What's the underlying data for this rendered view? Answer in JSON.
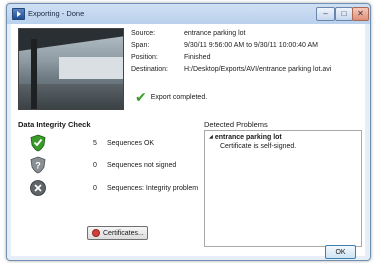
{
  "window": {
    "title": "Exporting - Done",
    "min": "–",
    "max": "□",
    "close": "✕"
  },
  "export_info": {
    "source_label": "Source:",
    "source_value": "entrance parking lot",
    "span_label": "Span:",
    "span_value": "9/30/11 9:56:00 AM to 9/30/11 10:00:40 AM",
    "position_label": "Position:",
    "position_value": "Finished",
    "destination_label": "Destination:",
    "destination_value": "H:/Desktop/Exports/AVI/entrance parking lot.avi"
  },
  "status": {
    "icon": "checkmark-icon",
    "text": "Export completed."
  },
  "integrity": {
    "title": "Data Integrity Check",
    "rows": [
      {
        "icon": "shield-ok-icon",
        "count": "5",
        "label": "Sequences OK"
      },
      {
        "icon": "shield-unsigned-icon",
        "count": "0",
        "label": "Sequences not signed"
      },
      {
        "icon": "shield-problem-icon",
        "count": "0",
        "label": "Sequences: Integrity problem"
      }
    ],
    "certificates_button": "Certificates..."
  },
  "problems": {
    "title": "Detected Problems",
    "node": "entrance parking lot",
    "child": "Certificate is self-signed."
  },
  "ok_button": "OK",
  "colors": {
    "ok_shield": "#3a9a2a",
    "gray_shield": "#8a8f93",
    "problem_shield": "#5f6469",
    "accent": "#3c7fb1"
  }
}
